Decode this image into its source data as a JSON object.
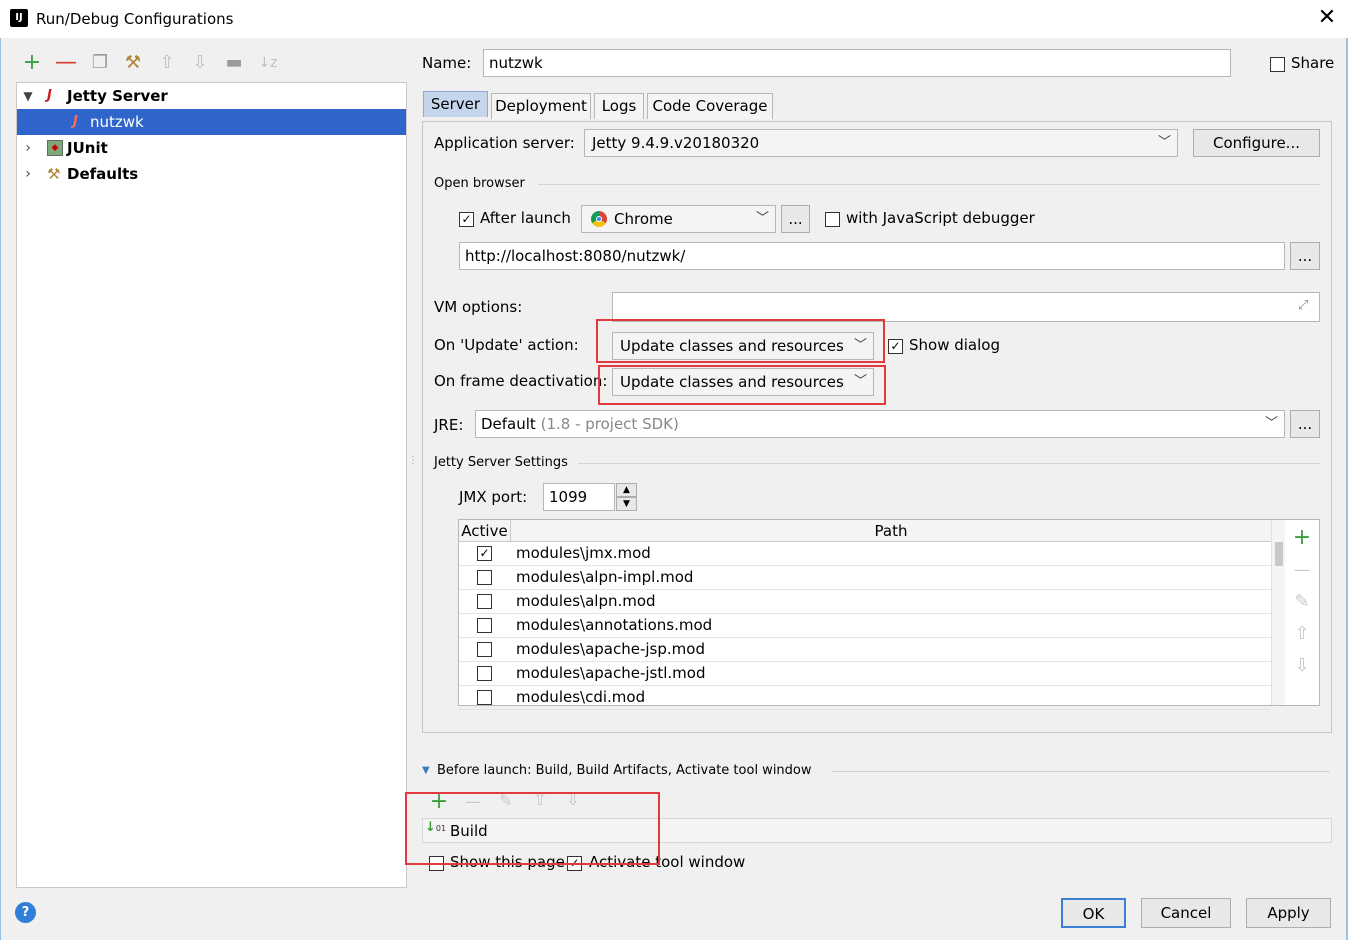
{
  "window": {
    "title": "Run/Debug Configurations",
    "app_icon": "intellij-icon",
    "close": "✕"
  },
  "toolbar": {
    "add": "+",
    "remove": "—"
  },
  "tree": [
    {
      "label": "Jetty Server",
      "expanded": true
    },
    {
      "label": "nutzwk",
      "selected": true
    },
    {
      "label": "JUnit"
    },
    {
      "label": "Defaults"
    }
  ],
  "name_field": {
    "label": "Name:",
    "value": "nutzwk"
  },
  "share": {
    "label": "Share",
    "checked": false
  },
  "tabs": [
    "Server",
    "Deployment",
    "Logs",
    "Code Coverage"
  ],
  "server": {
    "app_server_label": "Application server:",
    "app_server_value": "Jetty 9.4.9.v20180320",
    "configure_label": "Configure...",
    "open_browser_label": "Open browser",
    "after_launch_label": "After launch",
    "browser_value": "Chrome",
    "ellipsis": "...",
    "js_debugger_label": "with JavaScript debugger",
    "url_value": "http://localhost:8080/nutzwk/",
    "vm_options_label": "VM options:",
    "vm_options_value": "",
    "on_update_label": "On 'Update' action:",
    "on_update_value": "Update classes and resources",
    "show_dialog_label": "Show dialog",
    "on_frame_label": "On frame deactivation:",
    "on_frame_value": "Update classes and resources",
    "jre_label": "JRE:",
    "jre_value": "Default",
    "jre_hint": "(1.8 - project SDK)",
    "jetty_settings_label": "Jetty Server Settings",
    "jmx_port_label": "JMX port:",
    "jmx_port_value": "1099"
  },
  "modules_table": {
    "headers": [
      "Active",
      "Path"
    ],
    "rows": [
      {
        "active": true,
        "path": "modules\\jmx.mod"
      },
      {
        "active": false,
        "path": "modules\\alpn-impl.mod"
      },
      {
        "active": false,
        "path": "modules\\alpn.mod"
      },
      {
        "active": false,
        "path": "modules\\annotations.mod"
      },
      {
        "active": false,
        "path": "modules\\apache-jsp.mod"
      },
      {
        "active": false,
        "path": "modules\\apache-jstl.mod"
      },
      {
        "active": false,
        "path": "modules\\cdi.mod"
      }
    ]
  },
  "before_launch": {
    "header": "Before launch: Build, Build Artifacts, Activate tool window",
    "item": "Build",
    "show_page_label": "Show this page",
    "activate_label": "Activate tool window"
  },
  "footer": {
    "help": "?",
    "ok": "OK",
    "cancel": "Cancel",
    "apply": "Apply"
  },
  "colors": {
    "selection": "#2f65ca",
    "highlight_box": "#e0393e",
    "add_green": "#3b9e3b",
    "remove_red": "#d8392e"
  }
}
